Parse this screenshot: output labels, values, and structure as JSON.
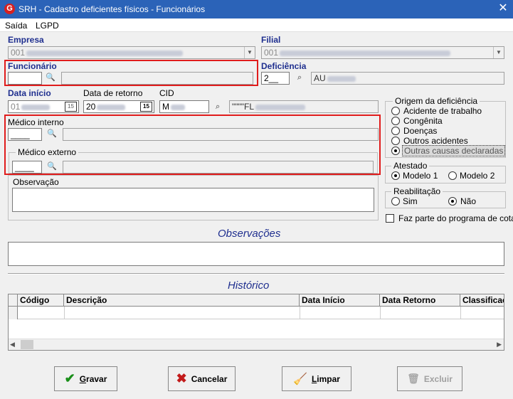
{
  "window": {
    "title": "SRH - Cadastro deficientes físicos - Funcionários",
    "app_icon_letter": "G"
  },
  "menu": {
    "items": [
      "Saída",
      "LGPD"
    ]
  },
  "form": {
    "empresa": {
      "label": "Empresa",
      "value": "001"
    },
    "filial": {
      "label": "Filial",
      "value": "001"
    },
    "funcionario": {
      "label": "Funcionário",
      "value": "",
      "name": ""
    },
    "deficiencia": {
      "label": "Deficiência",
      "code": "2__",
      "description": "AU"
    },
    "data_inicio": {
      "label": "Data início",
      "value": "01"
    },
    "data_retorno": {
      "label": "Data de retorno",
      "value": "20"
    },
    "cid": {
      "label": "CID",
      "value": "M",
      "description": "\"\"\"\"FL"
    },
    "medico_interno": {
      "label": "Médico interno",
      "value": "____"
    },
    "medico_externo": {
      "label": "Médico externo",
      "value": "____"
    },
    "observacao": {
      "label": "Observação",
      "value": ""
    }
  },
  "origem": {
    "title": "Origem da deficiência",
    "options": [
      "Acidente de trabalho",
      "Congênita",
      "Doenças",
      "Outros acidentes",
      "Outras causas declaradas"
    ],
    "selected_index": 4
  },
  "atestado": {
    "title": "Atestado",
    "options": [
      "Modelo 1",
      "Modelo 2"
    ],
    "selected_index": 0
  },
  "reabilitacao": {
    "title": "Reabilitação",
    "options": [
      "Sim",
      "Não"
    ],
    "selected_index": 1
  },
  "programa_cotas": {
    "label": "Faz parte do programa de cotas",
    "checked": false
  },
  "observacoes_section": {
    "title": "Observações"
  },
  "historico": {
    "title": "Histórico",
    "columns": [
      "Código",
      "Descrição",
      "Data Início",
      "Data Retorno",
      "Classificac"
    ]
  },
  "buttons": {
    "gravar": "Gravar",
    "cancelar": "Cancelar",
    "limpar": "Limpar",
    "excluir": "Excluir"
  },
  "colors": {
    "titlebar": "#2b63b8",
    "highlight": "#e01c1c",
    "label_blue": "#1f2f8f"
  }
}
